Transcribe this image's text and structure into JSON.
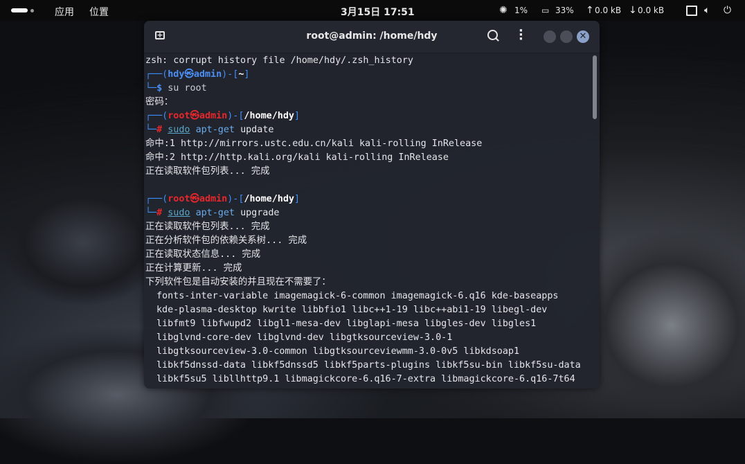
{
  "panel": {
    "apps": "应用",
    "places": "位置",
    "clock": "3月15日 17:51",
    "cpu": "1%",
    "mem": "33%",
    "net_up": "0.0 kB",
    "net_down": "0.0 kB",
    "icons": [
      "cpu-icon",
      "memory-icon",
      "upload-arrow-icon",
      "download-arrow-icon",
      "window-icon",
      "volume-icon",
      "power-icon"
    ]
  },
  "terminal": {
    "title": "root@admin: /home/hdy",
    "lines": [
      "zsh: corrupt history file /home/hdy/.zsh_history",
      {
        "user": "hdy",
        "host": "admin",
        "dir": "~",
        "sym": "$",
        "cmd": "su root"
      },
      "密码：",
      {
        "user": "root",
        "host": "admin",
        "dir": "/home/hdy",
        "sym": "#",
        "cmd_sudo": "sudo",
        "cmd_apt": "apt-get",
        "cmd_arg": "update"
      },
      "命中:1 http://mirrors.ustc.edu.cn/kali kali-rolling InRelease",
      "命中:2 http://http.kali.org/kali kali-rolling InRelease",
      "正在读取软件包列表... 完成",
      "",
      {
        "user": "root",
        "host": "admin",
        "dir": "/home/hdy",
        "sym": "#",
        "cmd_sudo": "sudo",
        "cmd_apt": "apt-get",
        "cmd_arg": "upgrade"
      },
      "正在读取软件包列表... 完成",
      "正在分析软件包的依赖关系树... 完成",
      "正在读取状态信息... 完成",
      "正在计算更新... 完成",
      "下列软件包是自动安装的并且现在不需要了：",
      "fonts-inter-variable imagemagick-6-common imagemagick-6.q16 kde-baseapps",
      "kde-plasma-desktop kwrite libbfio1 libc++1-19 libc++abi1-19 libegl-dev",
      "libfmt9 libfwupd2 libgl1-mesa-dev libglapi-mesa libgles-dev libgles1",
      "libglvnd-core-dev libglvnd-dev libgtksourceview-3.0-1",
      "libgtksourceview-3.0-common libgtksourceviewmm-3.0-0v5 libkdsoap1",
      "libkf5dnssd-data libkf5dnssd5 libkf5parts-plugins libkf5su-bin libkf5su-data",
      "libkf5su5 libllhttp9.1 libmagickcore-6.q16-7-extra libmagickcore-6.q16-7t64"
    ]
  }
}
